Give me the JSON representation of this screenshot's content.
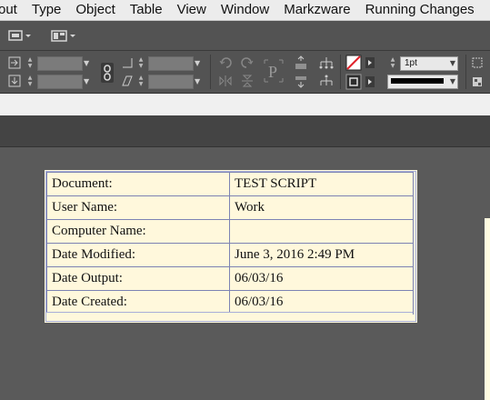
{
  "menu": [
    "out",
    "Type",
    "Object",
    "Table",
    "View",
    "Window",
    "Markzware",
    "Running Changes"
  ],
  "control_panel": {
    "stroke_weight": "1pt"
  },
  "document_table": {
    "rows": [
      {
        "label": "Document:",
        "value": "TEST SCRIPT"
      },
      {
        "label": "User Name:",
        "value": "Work"
      },
      {
        "label": "Computer Name:",
        "value": ""
      },
      {
        "label": "Date Modified:",
        "value": "June 3, 2016 2:49 PM"
      },
      {
        "label": "Date Output:",
        "value": "06/03/16"
      },
      {
        "label": "Date Created:",
        "value": "06/03/16"
      }
    ]
  },
  "colors": {
    "table_fill": "#fff8dc",
    "table_border": "#7d83b3",
    "pasteboard": "#5a5a5a"
  }
}
